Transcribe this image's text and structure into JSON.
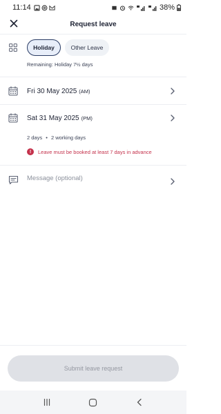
{
  "status_bar": {
    "time": "11:14",
    "battery": "38%"
  },
  "header": {
    "title": "Request leave",
    "close_icon": "close-icon"
  },
  "leave_type": {
    "options": [
      "Holiday",
      "Other Leave"
    ],
    "selected": "Holiday",
    "remaining": "Remaining: Holiday 7½ days"
  },
  "dates": {
    "start": {
      "date": "Fri 30 May 2025",
      "half": "(AM)"
    },
    "end": {
      "date": "Sat 31 May 2025",
      "half": "(PM)"
    }
  },
  "summary": {
    "days": "2 days",
    "separator": "•",
    "working_days": "2 working days"
  },
  "warning": {
    "icon_glyph": "!",
    "text": "Leave must be booked at least 7 days in advance",
    "color": "#c4314b"
  },
  "message": {
    "placeholder": "Message (optional)"
  },
  "submit": {
    "label": "Submit leave request"
  },
  "colors": {
    "accent_border": "#283a63",
    "chip_selected_bg": "#e8eef9",
    "error": "#c4314b",
    "disabled_button": "#dfe1e6"
  }
}
